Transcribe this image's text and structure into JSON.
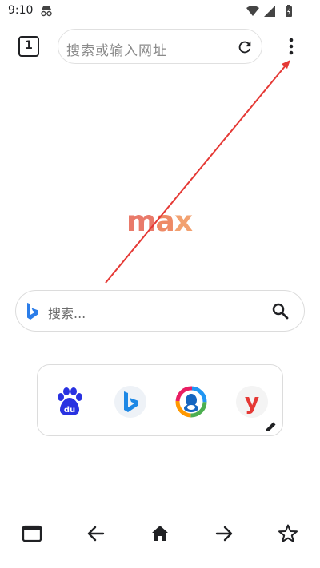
{
  "status_bar": {
    "time": "9:10",
    "icons": [
      "incognito-icon",
      "wifi-icon",
      "signal-icon",
      "battery-icon"
    ]
  },
  "toolbar": {
    "tab_count": "1",
    "address_placeholder": "搜索或输入网址",
    "icons": [
      "tab-switcher-icon",
      "reload-icon",
      "more-vert-icon"
    ]
  },
  "logo": {
    "text_m": "m",
    "text_a": "a",
    "text_x": "x"
  },
  "search": {
    "placeholder": "搜索...",
    "engine_icon": "bing-icon",
    "button_icon": "search-icon"
  },
  "shortcuts": [
    {
      "name": "baidu",
      "icon": "baidu-icon"
    },
    {
      "name": "bing",
      "icon": "bing-icon"
    },
    {
      "name": "qq",
      "icon": "qq-icon"
    },
    {
      "name": "y",
      "icon": "y-icon"
    }
  ],
  "bottom_bar": {
    "items": [
      "tabs-icon",
      "back-icon",
      "home-icon",
      "forward-icon",
      "bookmark-star-icon"
    ]
  },
  "colors": {
    "accent_red": "#e53935",
    "logo_gradient": [
      "#e97a6a",
      "#ee8a66",
      "#f2a170"
    ],
    "bing_blue": "#2b7de9",
    "baidu_blue": "#2932e1"
  }
}
